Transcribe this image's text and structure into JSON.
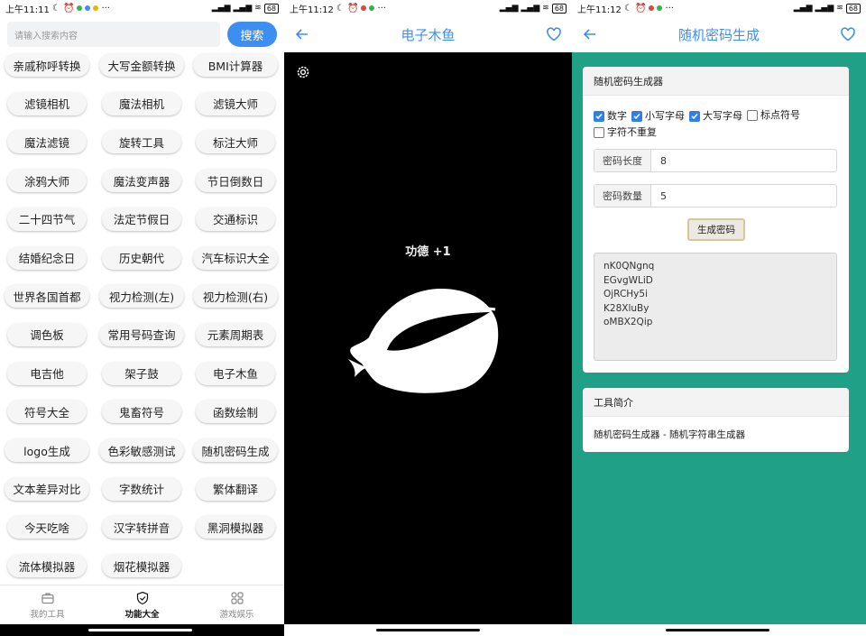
{
  "screen1": {
    "status_time": "上午11:11",
    "status_battery": "68",
    "search_placeholder": "请输入搜索内容",
    "search_button": "搜索",
    "tools": [
      "亲戚称呼转换",
      "大写金额转换",
      "BMI计算器",
      "滤镜相机",
      "魔法相机",
      "滤镜大师",
      "魔法滤镜",
      "旋转工具",
      "标注大师",
      "涂鸦大师",
      "魔法变声器",
      "节日倒数日",
      "二十四节气",
      "法定节假日",
      "交通标识",
      "结婚纪念日",
      "历史朝代",
      "汽车标识大全",
      "世界各国首都",
      "视力检测(左)",
      "视力检测(右)",
      "调色板",
      "常用号码查询",
      "元素周期表",
      "电吉他",
      "架子鼓",
      "电子木鱼",
      "符号大全",
      "鬼畜符号",
      "函数绘制",
      "logo生成",
      "色彩敏感测试",
      "随机密码生成",
      "文本差异对比",
      "字数统计",
      "繁体翻译",
      "今天吃啥",
      "汉字转拼音",
      "黑洞模拟器",
      "流体模拟器",
      "烟花模拟器"
    ],
    "tabs": [
      {
        "label": "我的工具",
        "icon": "briefcase-icon"
      },
      {
        "label": "功能大全",
        "icon": "shield-icon"
      },
      {
        "label": "游戏娱乐",
        "icon": "grid-icon"
      }
    ]
  },
  "screen2": {
    "status_time": "上午11:12",
    "status_battery": "68",
    "title": "电子木鱼",
    "merit_text": "功德 +1"
  },
  "screen3": {
    "status_time": "上午11:12",
    "status_battery": "68",
    "title": "随机密码生成",
    "card_title": "随机密码生成器",
    "options": [
      {
        "label": "数字",
        "checked": true
      },
      {
        "label": "小写字母",
        "checked": true
      },
      {
        "label": "大写字母",
        "checked": true
      },
      {
        "label": "标点符号",
        "checked": false
      },
      {
        "label": "字符不重复",
        "checked": false
      }
    ],
    "length_label": "密码长度",
    "length_value": "8",
    "count_label": "密码数量",
    "count_value": "5",
    "generate_button": "生成密码",
    "passwords": [
      "nK0QNgnq",
      "EGvgWLiD",
      "OjRCHy5i",
      "K28XluBy",
      "oMBX2Qip"
    ],
    "intro_title": "工具简介",
    "intro_text": "随机密码生成器 - 随机字符串生成器"
  },
  "colors": {
    "accent": "#3c8ef0",
    "teal": "#20a086",
    "checkbox": "#2f7fe4"
  }
}
